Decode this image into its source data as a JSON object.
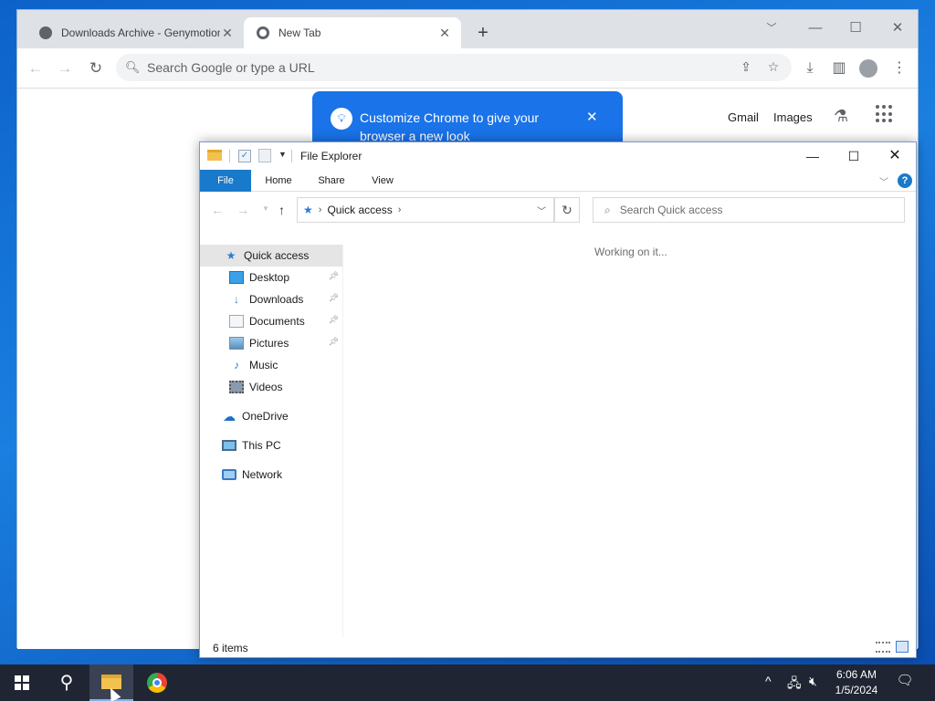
{
  "chrome": {
    "tabs": [
      {
        "title": "Downloads Archive - Genymotion"
      },
      {
        "title": "New Tab"
      }
    ],
    "omnibox_placeholder": "Search Google or type a URL",
    "page_links": {
      "gmail": "Gmail",
      "images": "Images"
    },
    "callout": "Customize Chrome to give your browser a new look"
  },
  "explorer": {
    "title": "File Explorer",
    "ribbon_tabs": [
      "File",
      "Home",
      "Share",
      "View"
    ],
    "address": "Quick access",
    "search_placeholder": "Search Quick access",
    "nav": {
      "quick_access": "Quick access",
      "desktop": "Desktop",
      "downloads": "Downloads",
      "documents": "Documents",
      "pictures": "Pictures",
      "music": "Music",
      "videos": "Videos",
      "onedrive": "OneDrive",
      "this_pc": "This PC",
      "network": "Network"
    },
    "content_status": "Working on it...",
    "status_bar": "6 items"
  },
  "taskbar": {
    "time": "6:06 AM",
    "date": "1/5/2024"
  },
  "colors": {
    "accent": "#1979ca",
    "chrome_blue": "#1a73e8",
    "taskbar": "#1f2532"
  }
}
